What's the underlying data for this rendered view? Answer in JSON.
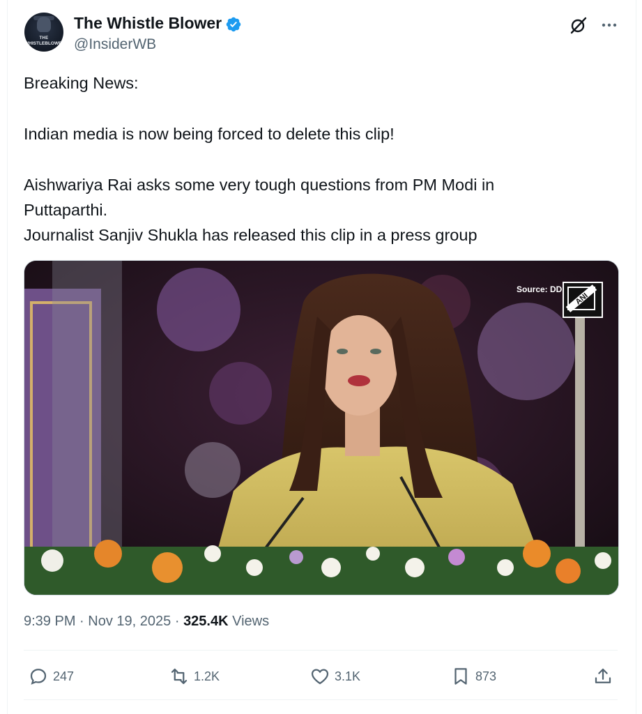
{
  "author": {
    "name": "The Whistle Blower",
    "handle": "@InsiderWB",
    "avatar_text_line1": "THE",
    "avatar_text_line2": "WHISTLEBLOWER",
    "verified": true
  },
  "post": {
    "lines": [
      "Breaking News:",
      "Indian media is now being forced to delete this clip!",
      "Aishwariya Rai asks some very tough questions from PM Modi in",
      "Puttaparthi.",
      "Journalist Sanjiv Shukla has released this clip in a press group"
    ]
  },
  "media": {
    "source_label": "Source: DD",
    "logo_text": "ANI"
  },
  "meta": {
    "time": "9:39 PM",
    "separator": "·",
    "date": "Nov 19, 2025",
    "views_count": "325.4K",
    "views_label": "Views"
  },
  "actions": {
    "replies": "247",
    "reposts": "1.2K",
    "likes": "3.1K",
    "bookmarks": "873"
  },
  "icons": {
    "verified": "verified-badge-icon",
    "grok": "grok-icon",
    "more": "more-icon",
    "reply": "reply-icon",
    "repost": "repost-icon",
    "like": "heart-icon",
    "bookmark": "bookmark-icon",
    "share": "share-icon"
  },
  "colors": {
    "text": "#0f1419",
    "secondary": "#536471",
    "verified": "#1d9bf0",
    "border": "#eff3f4"
  }
}
